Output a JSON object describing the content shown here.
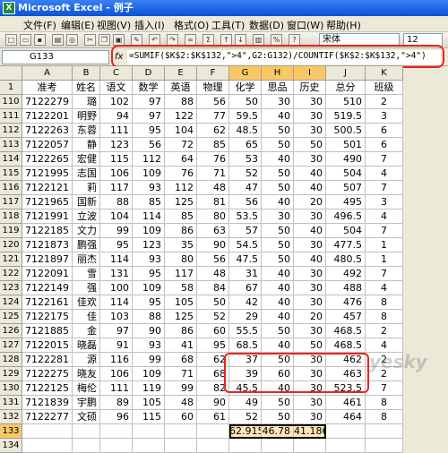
{
  "title": "Microsoft Excel - 例子",
  "menu": [
    "文件(F)",
    "编辑(E)",
    "视图(V)",
    "插入(I)",
    "格式(O)",
    "工具(T)",
    "数据(D)",
    "窗口(W)",
    "帮助(H)"
  ],
  "font_name": "宋体",
  "font_size": "12",
  "name_box": "G133",
  "fx_label": "fx",
  "formula": "=SUMIF($K$2:$K$132,\">4\",G2:G132)/COUNTIF($K$2:$K$132,\">4\")",
  "columns": [
    "A",
    "B",
    "C",
    "D",
    "E",
    "F",
    "G",
    "H",
    "I",
    "J",
    "K"
  ],
  "selected_columns": [
    "G",
    "H",
    "I"
  ],
  "headers": [
    "准考",
    "姓名",
    "语文",
    "数学",
    "英语",
    "物理",
    "化学",
    "思品",
    "历史",
    "总分",
    "班级"
  ],
  "header_row_num": "1",
  "rows": [
    {
      "n": "110",
      "a": "7122279",
      "b": "璐",
      "c": "102",
      "d": "97",
      "e": "88",
      "f": "56",
      "g": "50",
      "h": "30",
      "i": "30",
      "j": "510",
      "k": "2"
    },
    {
      "n": "111",
      "a": "7122201",
      "b": "明野",
      "c": "94",
      "d": "97",
      "e": "122",
      "f": "77",
      "g": "59.5",
      "h": "40",
      "i": "30",
      "j": "519.5",
      "k": "3"
    },
    {
      "n": "112",
      "a": "7122263",
      "b": "东蓉",
      "c": "111",
      "d": "95",
      "e": "104",
      "f": "62",
      "g": "48.5",
      "h": "50",
      "i": "30",
      "j": "500.5",
      "k": "6"
    },
    {
      "n": "113",
      "a": "7122057",
      "b": "静",
      "c": "123",
      "d": "56",
      "e": "72",
      "f": "85",
      "g": "65",
      "h": "50",
      "i": "50",
      "j": "501",
      "k": "6"
    },
    {
      "n": "114",
      "a": "7122265",
      "b": "宏健",
      "c": "115",
      "d": "112",
      "e": "64",
      "f": "76",
      "g": "53",
      "h": "40",
      "i": "30",
      "j": "490",
      "k": "7"
    },
    {
      "n": "115",
      "a": "7121995",
      "b": "志国",
      "c": "106",
      "d": "109",
      "e": "76",
      "f": "71",
      "g": "52",
      "h": "50",
      "i": "40",
      "j": "504",
      "k": "4"
    },
    {
      "n": "116",
      "a": "7122121",
      "b": "莉",
      "c": "117",
      "d": "93",
      "e": "112",
      "f": "48",
      "g": "47",
      "h": "50",
      "i": "40",
      "j": "507",
      "k": "7"
    },
    {
      "n": "117",
      "a": "7121965",
      "b": "国新",
      "c": "88",
      "d": "85",
      "e": "125",
      "f": "81",
      "g": "56",
      "h": "40",
      "i": "20",
      "j": "495",
      "k": "3"
    },
    {
      "n": "118",
      "a": "7121991",
      "b": "立波",
      "c": "104",
      "d": "114",
      "e": "85",
      "f": "80",
      "g": "53.5",
      "h": "30",
      "i": "30",
      "j": "496.5",
      "k": "4"
    },
    {
      "n": "119",
      "a": "7122185",
      "b": "文力",
      "c": "99",
      "d": "109",
      "e": "86",
      "f": "63",
      "g": "57",
      "h": "50",
      "i": "40",
      "j": "504",
      "k": "7"
    },
    {
      "n": "120",
      "a": "7121873",
      "b": "鹏强",
      "c": "95",
      "d": "123",
      "e": "35",
      "f": "90",
      "g": "54.5",
      "h": "50",
      "i": "30",
      "j": "477.5",
      "k": "1"
    },
    {
      "n": "121",
      "a": "7121897",
      "b": "丽杰",
      "c": "114",
      "d": "93",
      "e": "80",
      "f": "56",
      "g": "47.5",
      "h": "50",
      "i": "40",
      "j": "480.5",
      "k": "1"
    },
    {
      "n": "122",
      "a": "7122091",
      "b": "雪",
      "c": "131",
      "d": "95",
      "e": "117",
      "f": "48",
      "g": "31",
      "h": "40",
      "i": "30",
      "j": "492",
      "k": "7"
    },
    {
      "n": "123",
      "a": "7122149",
      "b": "强",
      "c": "100",
      "d": "109",
      "e": "58",
      "f": "84",
      "g": "67",
      "h": "40",
      "i": "30",
      "j": "488",
      "k": "4"
    },
    {
      "n": "124",
      "a": "7122161",
      "b": "佳欢",
      "c": "114",
      "d": "95",
      "e": "105",
      "f": "50",
      "g": "42",
      "h": "40",
      "i": "30",
      "j": "476",
      "k": "8"
    },
    {
      "n": "125",
      "a": "7122175",
      "b": "佳",
      "c": "103",
      "d": "88",
      "e": "125",
      "f": "52",
      "g": "29",
      "h": "40",
      "i": "20",
      "j": "457",
      "k": "8"
    },
    {
      "n": "126",
      "a": "7121885",
      "b": "金",
      "c": "97",
      "d": "90",
      "e": "86",
      "f": "60",
      "g": "55.5",
      "h": "50",
      "i": "30",
      "j": "468.5",
      "k": "2"
    },
    {
      "n": "127",
      "a": "7122015",
      "b": "晓磊",
      "c": "91",
      "d": "93",
      "e": "41",
      "f": "95",
      "g": "68.5",
      "h": "40",
      "i": "50",
      "j": "468.5",
      "k": "4"
    },
    {
      "n": "128",
      "a": "7122281",
      "b": "源",
      "c": "116",
      "d": "99",
      "e": "68",
      "f": "62",
      "g": "37",
      "h": "50",
      "i": "30",
      "j": "462",
      "k": "2"
    },
    {
      "n": "129",
      "a": "7122275",
      "b": "晓友",
      "c": "106",
      "d": "109",
      "e": "71",
      "f": "68",
      "g": "39",
      "h": "60",
      "i": "30",
      "j": "463",
      "k": "2"
    },
    {
      "n": "130",
      "a": "7122125",
      "b": "梅伦",
      "c": "111",
      "d": "119",
      "e": "99",
      "f": "82",
      "g": "45.5",
      "h": "40",
      "i": "30",
      "j": "523.5",
      "k": "7"
    },
    {
      "n": "131",
      "a": "7121839",
      "b": "宇鹏",
      "c": "89",
      "d": "105",
      "e": "48",
      "f": "90",
      "g": "49",
      "h": "50",
      "i": "30",
      "j": "461",
      "k": "8"
    },
    {
      "n": "132",
      "a": "7122277",
      "b": "文硕",
      "c": "96",
      "d": "115",
      "e": "60",
      "f": "61",
      "g": "52",
      "h": "50",
      "i": "30",
      "j": "464",
      "k": "8"
    }
  ],
  "result_row": {
    "n": "133",
    "g": "62.915",
    "h": "46.78",
    "i": "41.186"
  },
  "empty_row": {
    "n": "134"
  },
  "watermark": "yesky"
}
